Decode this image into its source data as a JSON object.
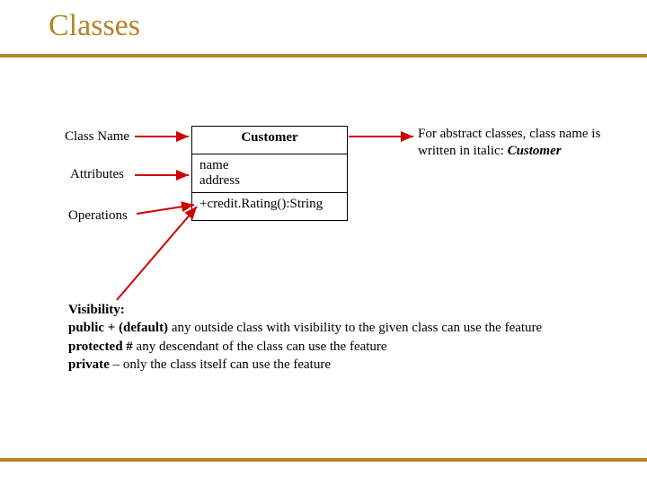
{
  "title": "Classes",
  "labels": {
    "className": "Class Name",
    "attributes": "Attributes",
    "operations": "Operations"
  },
  "uml": {
    "name": "Customer",
    "attributes": [
      "name",
      "address"
    ],
    "operations": [
      "+credit.Rating():String"
    ]
  },
  "abstractNote": {
    "line1": "For abstract classes, class name is",
    "line2_prefix": "written in italic: ",
    "line2_italic": "Customer"
  },
  "visibility": {
    "heading": "Visibility:",
    "public": {
      "bold": "public + (default)",
      "rest": " any outside class with visibility to the given class can use the feature"
    },
    "protected": {
      "bold": "protected #",
      "rest": " any descendant of the class can use the feature"
    },
    "private": {
      "bold": "private",
      "rest": " – only the class itself can use the feature"
    }
  },
  "colors": {
    "accent": "#b38429",
    "arrow": "#cf0000"
  }
}
